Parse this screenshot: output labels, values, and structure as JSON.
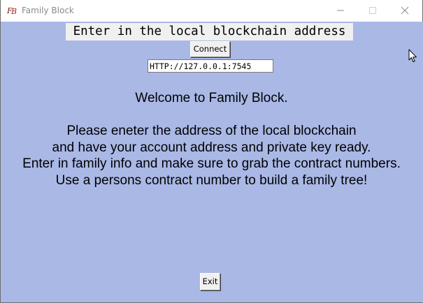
{
  "window": {
    "title": "Family Block",
    "app_icon": "fb-logo-icon",
    "controls": [
      "minimize-icon",
      "maximize-icon",
      "close-icon"
    ]
  },
  "header": {
    "label": "Enter in the local blockchain address"
  },
  "connect": {
    "button_label": "Connect",
    "address_value": "HTTP://127.0.0.1:7545"
  },
  "message": {
    "lines": [
      "Welcome to Family Block.",
      "",
      "Please eneter the address of the local blockchain",
      "and have your account address and private key ready.",
      "Enter in family info and make sure to grab the contract numbers.",
      "Use a persons contract number to build a family tree!"
    ]
  },
  "footer": {
    "exit_label": "Exit"
  },
  "colors": {
    "background": "#aab8e6",
    "button_face": "#f0f0f0",
    "title_text": "#8a8a8a"
  }
}
